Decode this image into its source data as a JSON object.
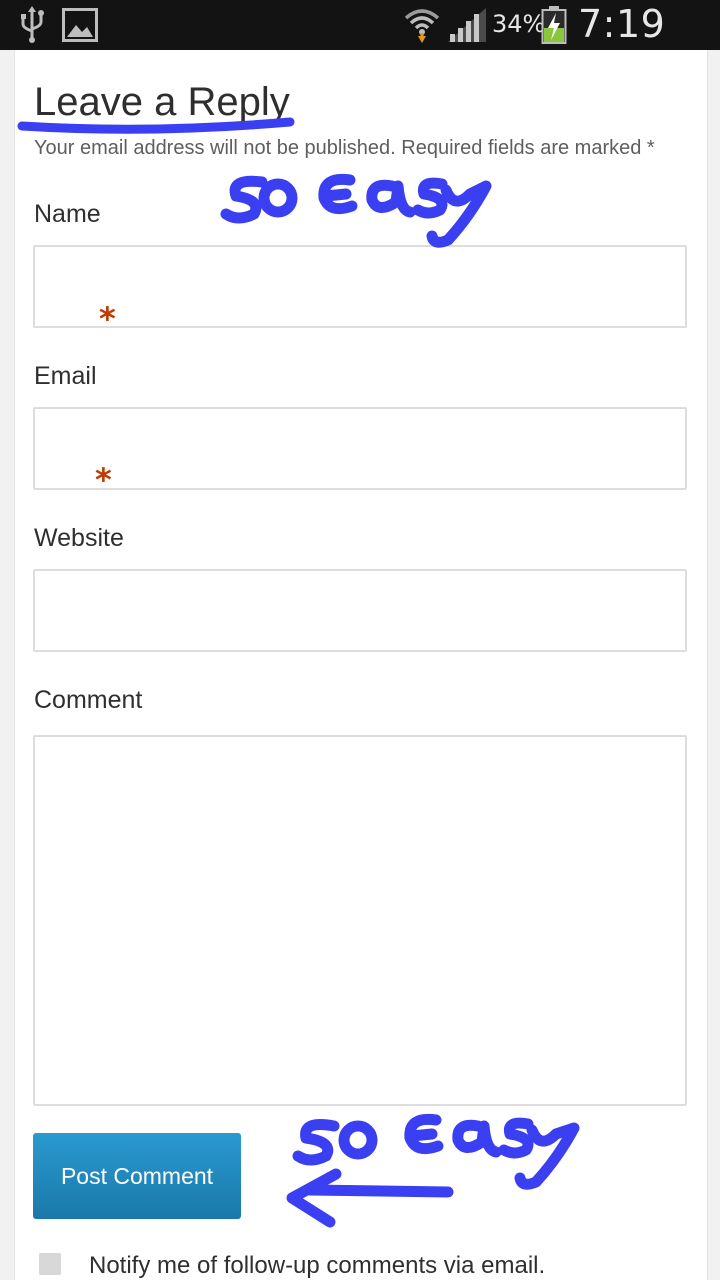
{
  "status_bar": {
    "battery_percent": "34%",
    "time": "7:19 PM",
    "icons": [
      "usb-icon",
      "image-icon",
      "wifi-icon",
      "signal-icon",
      "battery-charging-icon"
    ]
  },
  "form": {
    "title": "Leave a Reply",
    "notes": "Your email address will not be published. Required fields are marked *",
    "fields": [
      {
        "label": "Name",
        "value": "",
        "required": true
      },
      {
        "label": "Email",
        "value": "",
        "required": true
      },
      {
        "label": "Website",
        "value": "",
        "required": false
      },
      {
        "label": "Comment",
        "value": "",
        "required": false
      }
    ],
    "required_mark": "*",
    "submit_label": "Post Comment",
    "subscribe_label": "Notify me of follow-up comments via email.",
    "subscribe_checked": false
  },
  "annotations": {
    "handwritten_1": "so easy",
    "handwritten_2": "so easy",
    "ink_color": "#3a3ff2"
  },
  "colors": {
    "button": "#1f86bb",
    "required_mark": "#bf3b00",
    "status_bar": "#131313"
  }
}
